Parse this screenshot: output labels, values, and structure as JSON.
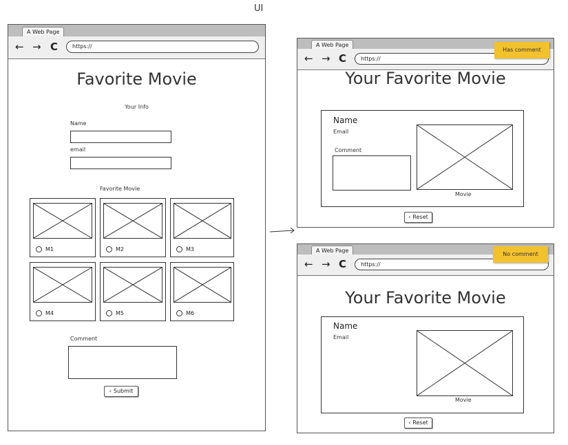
{
  "caption": "UI",
  "arrow_glyph": "→",
  "browser": {
    "tab_label": "A Web Page",
    "url": "https://",
    "back_icon": "←",
    "forward_icon": "→",
    "reload_icon": "C"
  },
  "form_page": {
    "title": "Favorite Movie",
    "section_info": "Your Info",
    "name_label": "Name",
    "email_label": "email",
    "section_movie": "Favorite Movie",
    "movies": [
      "M1",
      "M2",
      "M3",
      "M4",
      "M5",
      "M6"
    ],
    "comment_label": "Comment",
    "submit_label": "Submit"
  },
  "result_with_comment": {
    "note": "Has comment",
    "title": "Your Favorite Movie",
    "name_label": "Name",
    "email_label": "Email",
    "comment_label": "Comment",
    "movie_caption": "Movie",
    "reset_label": "Reset"
  },
  "result_no_comment": {
    "note": "No comment",
    "title": "Your Favorite Movie",
    "name_label": "Name",
    "email_label": "Email",
    "movie_caption": "Movie",
    "reset_label": "Reset"
  }
}
